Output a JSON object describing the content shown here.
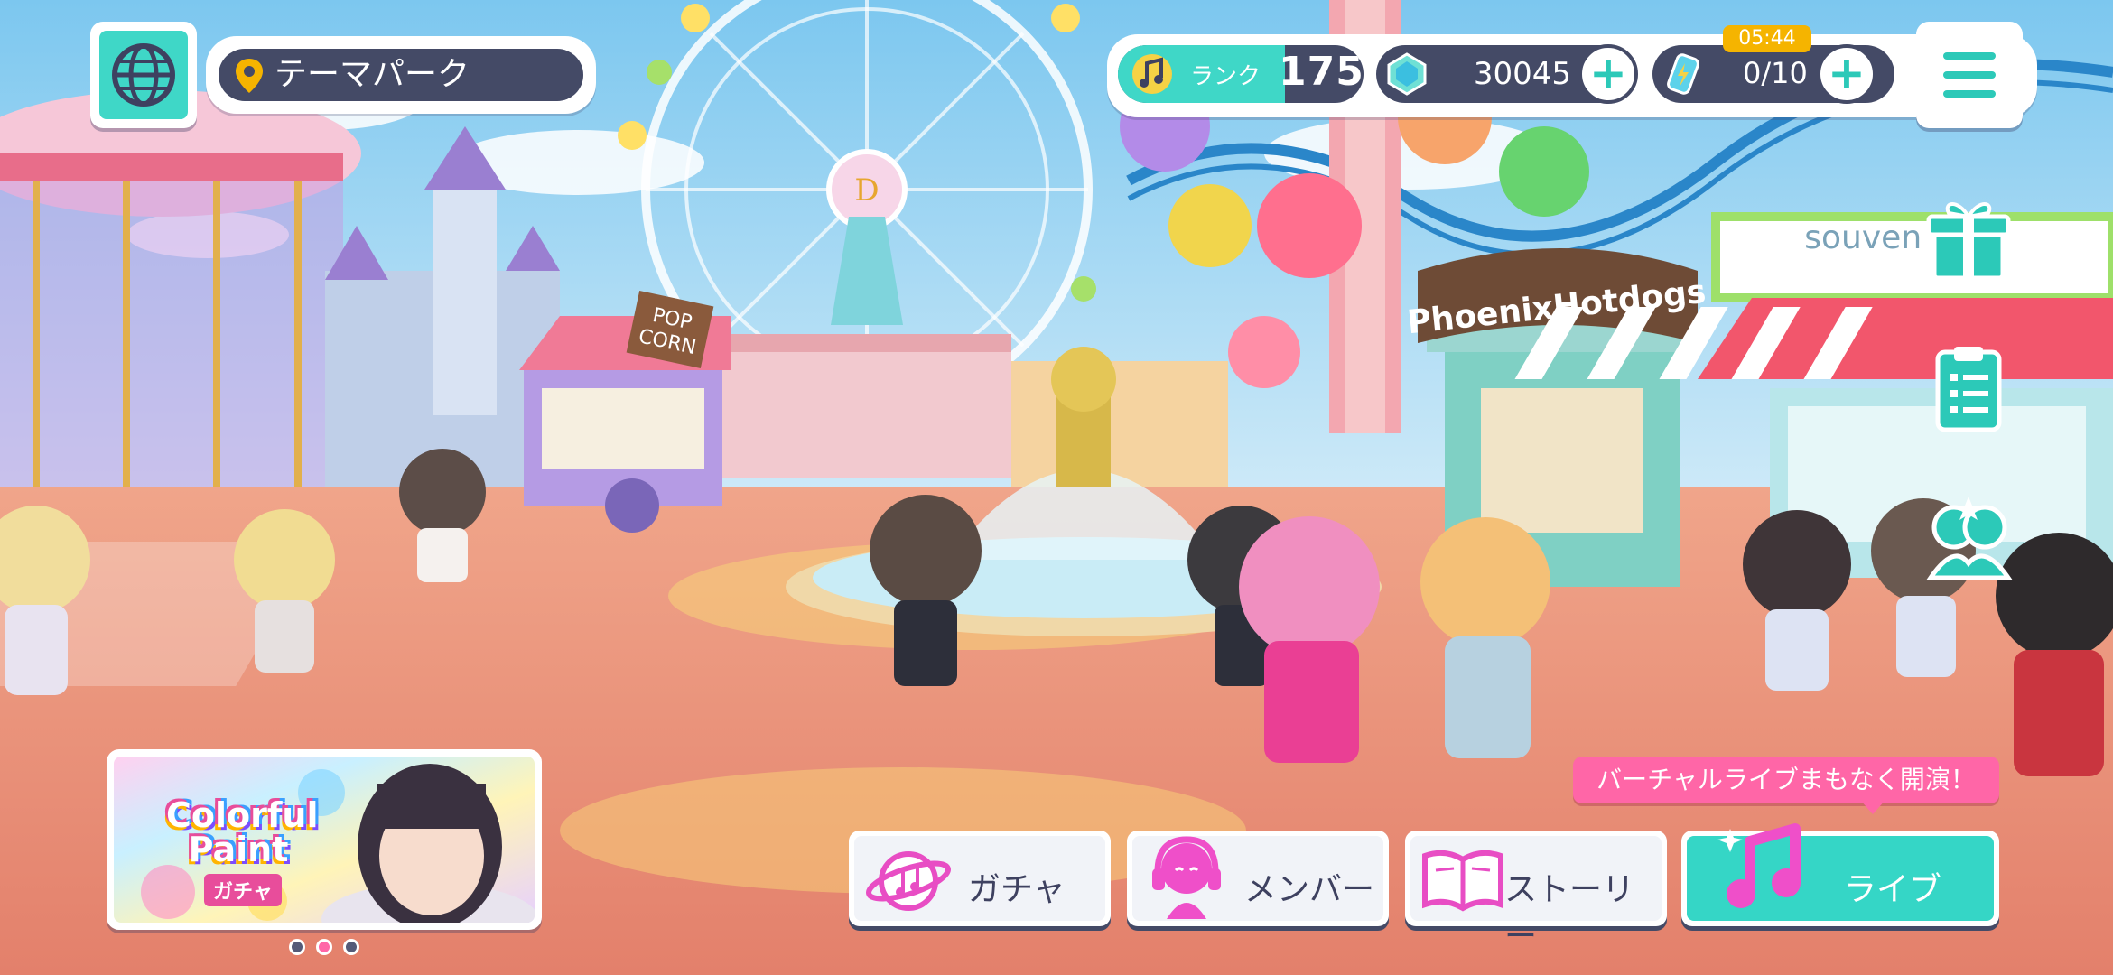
{
  "header": {
    "location": "テーマパーク",
    "rank_label": "ランク",
    "rank_value": "175",
    "rank_progress": 0.68,
    "crystals": "30045",
    "energy": "0/10",
    "energy_timer": "05:44"
  },
  "scene": {
    "signs": {
      "hotdogs": "PhoenixHotdogs",
      "souvenir": "souven    e",
      "popcorn_top": "POP",
      "popcorn_bottom": "CORN"
    }
  },
  "banner": {
    "title_line1": "Colorful",
    "title_line2": "Paint",
    "subtitle": "ガチャ",
    "page_count": 3,
    "active_page": 2
  },
  "nav": {
    "gacha": "ガチャ",
    "member": "メンバー",
    "story": "ストーリー",
    "live": "ライブ"
  },
  "notice": {
    "live_soon": "バーチャルライブまもなく開演！"
  },
  "icons": {
    "globe": "globe-icon",
    "location": "location-pin-icon",
    "rank": "music-note-icon",
    "crystal": "crystal-icon",
    "energy": "energy-bottle-icon",
    "menu": "hamburger-menu-icon",
    "gift": "gift-icon",
    "mission": "clipboard-icon",
    "friends": "friends-icon"
  },
  "colors": {
    "accent": "#3fd7c7",
    "dark": "#444a66",
    "pink": "#ff66a7",
    "timer": "#f5b400"
  }
}
